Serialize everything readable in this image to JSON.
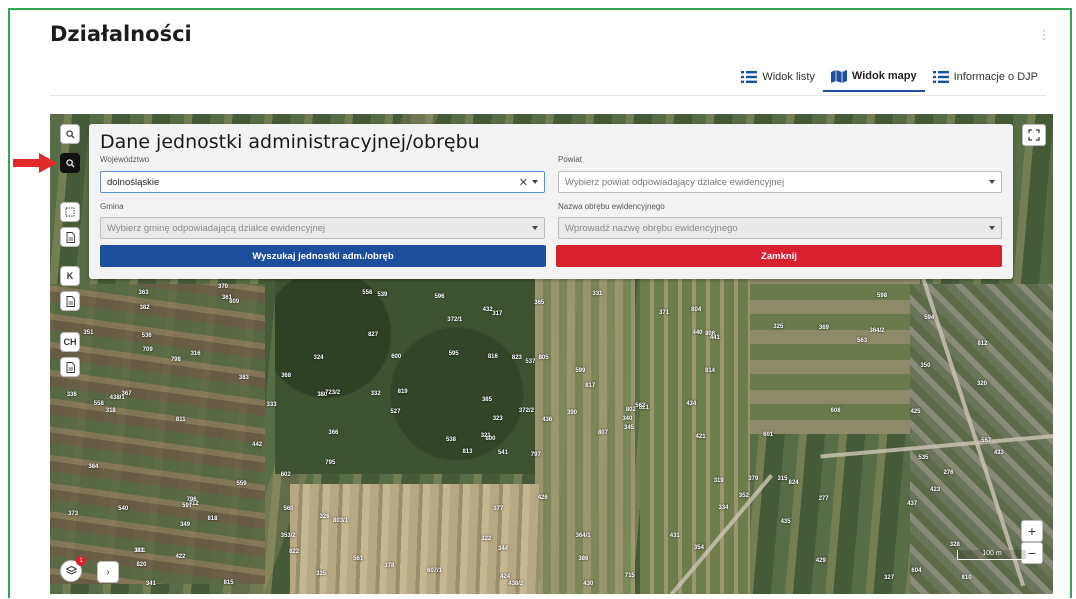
{
  "page": {
    "title": "Działalności",
    "menu_icon": "kebab-icon"
  },
  "tabs": [
    {
      "label": "Widok listy",
      "icon": "list-icon",
      "active": false
    },
    {
      "label": "Widok mapy",
      "icon": "map-icon",
      "active": true
    },
    {
      "label": "Informacje o DJP",
      "icon": "list-icon",
      "active": false
    }
  ],
  "toolbar": {
    "search_icon": "search-icon",
    "search_admin_icon": "search-admin-icon",
    "select_area_icon": "select-area-icon",
    "doc_icon": "document-icon",
    "k_label": "K",
    "ch_label": "CH"
  },
  "panel": {
    "title": "Dane jednostki administracyjnej/obrębu",
    "wojewodztwo": {
      "label": "Województwo",
      "value": "dolnośląskie"
    },
    "powiat": {
      "label": "Powiat",
      "placeholder": "Wybierz powiat odpowiadający działce ewidencyjnej"
    },
    "gmina": {
      "label": "Gmina",
      "placeholder": "Wybierz gminę odpowiadającą działce ewidencyjnej"
    },
    "obreb": {
      "label": "Nazwa obrębu ewidencyjnego",
      "placeholder": "Wprowadź nazwę obrębu ewidencyjnego"
    },
    "search_button": "Wyszukaj jednostki adm./obręb",
    "close_button": "Zamknij"
  },
  "map": {
    "zoom_in": "+",
    "zoom_out": "−",
    "scale": "100 m",
    "layers_badge": "1",
    "parcels": [
      "797",
      "798",
      "800",
      "801",
      "802",
      "803/1",
      "804",
      "805",
      "806",
      "807",
      "809",
      "810",
      "811",
      "812",
      "813",
      "814",
      "815",
      "816",
      "817",
      "818",
      "819",
      "820",
      "822",
      "823",
      "821",
      "824",
      "316",
      "317",
      "318",
      "319",
      "320",
      "321",
      "322",
      "323",
      "324",
      "325",
      "326",
      "327",
      "328",
      "315",
      "331",
      "332",
      "333",
      "334",
      "335",
      "336",
      "340",
      "341",
      "344",
      "345",
      "349",
      "350",
      "351",
      "352",
      "354",
      "353/2",
      "361",
      "363",
      "364/1",
      "364/2",
      "365",
      "366",
      "367",
      "368",
      "369",
      "370",
      "371",
      "372/1",
      "372/2",
      "373",
      "377",
      "378",
      "379",
      "380",
      "381",
      "382",
      "383",
      "384",
      "385",
      "386",
      "390",
      "422",
      "421",
      "423",
      "424",
      "425",
      "426",
      "429",
      "430",
      "431",
      "432",
      "433",
      "434",
      "435",
      "436",
      "437",
      "438/1",
      "438/2",
      "440",
      "441",
      "442",
      "556",
      "557",
      "558",
      "559",
      "560",
      "561",
      "562",
      "563",
      "527",
      "535",
      "536",
      "537",
      "538",
      "539",
      "540",
      "541",
      "594",
      "595",
      "596",
      "597",
      "598",
      "599",
      "600",
      "601",
      "602",
      "604",
      "607/1",
      "608",
      "709",
      "712",
      "715",
      "723/2",
      "827",
      "276",
      "277",
      "795",
      "796"
    ]
  }
}
